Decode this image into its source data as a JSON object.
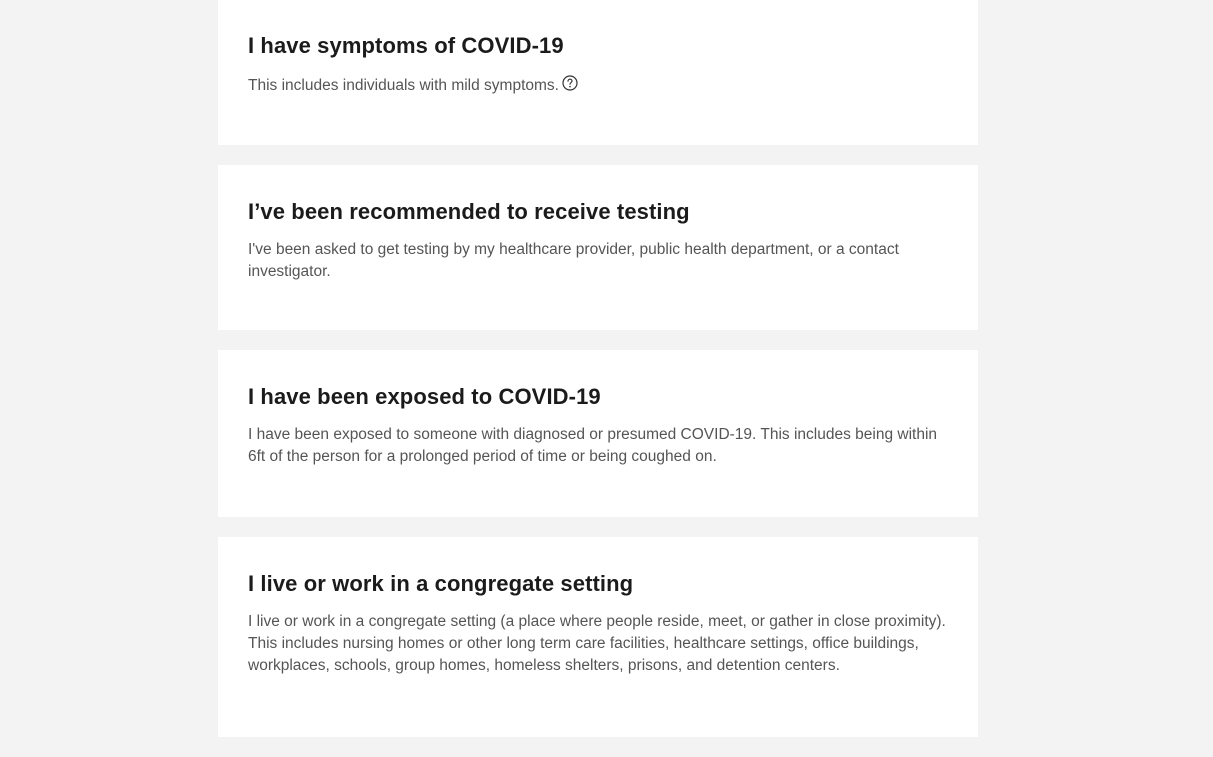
{
  "options": [
    {
      "title": "I have symptoms of COVID-19",
      "description": "This includes individuals with mild symptoms.",
      "help_icon": "question-circle-icon"
    },
    {
      "title": "I’ve been recommended to receive testing",
      "description": "I've been asked to get testing by my healthcare provider, public health department, or a contact investigator."
    },
    {
      "title": "I have been exposed to COVID-19",
      "description": "I have been exposed to someone with diagnosed or presumed COVID-19. This includes being within 6ft of the person for a prolonged period of time or being coughed on."
    },
    {
      "title": "I live or work in a congregate setting",
      "description": "I live or work in a congregate setting (a place where people reside, meet, or gather in close proximity). This includes nursing homes or other long term care facilities, healthcare settings, office buildings, workplaces, schools, group homes, homeless shelters, prisons, and detention centers."
    }
  ],
  "colors": {
    "page_background": "#f3f3f3",
    "card_background": "#ffffff",
    "title_text": "#1b1b1b",
    "body_text": "#555555"
  }
}
